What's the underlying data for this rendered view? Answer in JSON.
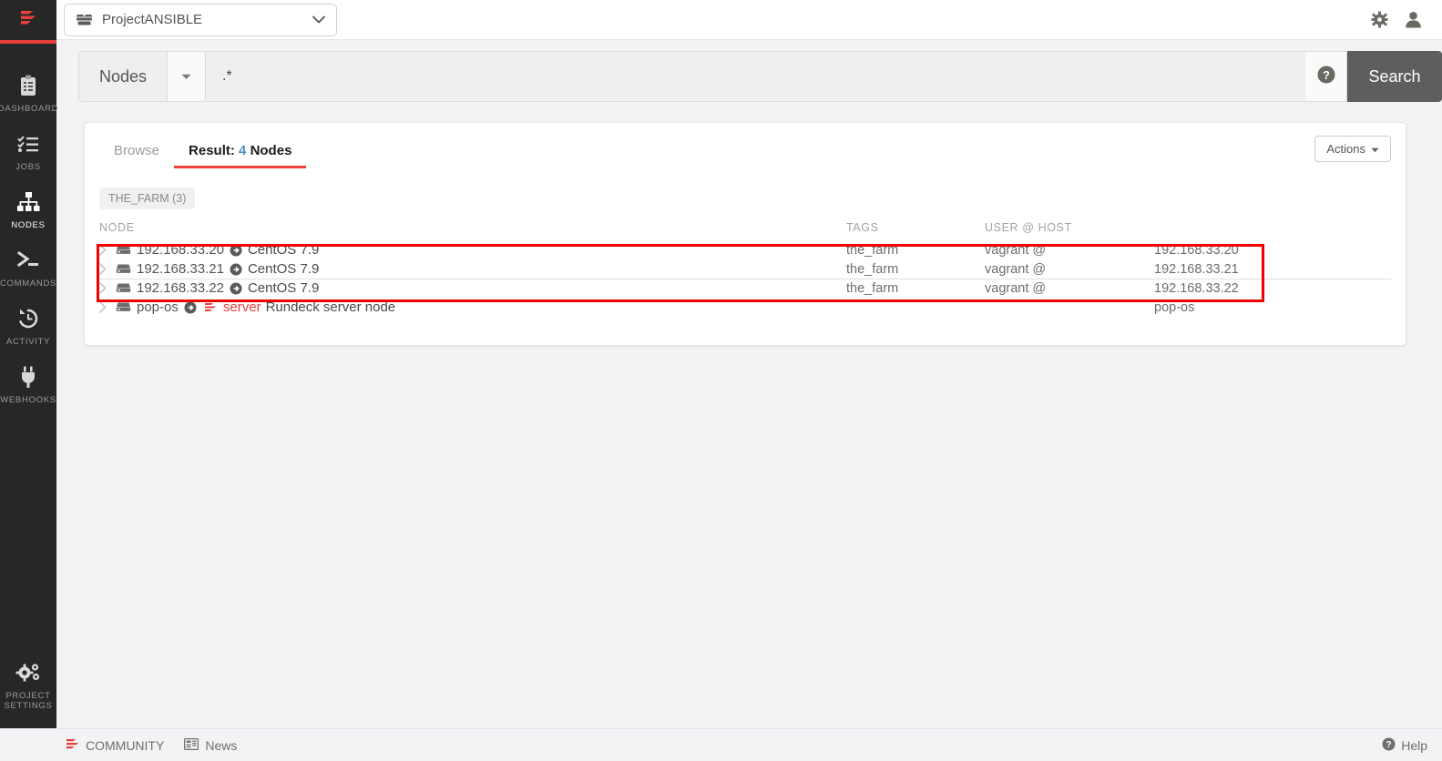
{
  "topbar": {
    "logo_icon": "rundeck-logo-icon",
    "project_name": "ProjectANSIBLE",
    "project_icon": "project-cube-icon",
    "caret_icon": "chevron-down-icon",
    "settings_icon": "gear-icon",
    "user_icon": "user-icon"
  },
  "sidebar": {
    "items": [
      {
        "label": "DASHBOARD",
        "icon": "clipboard-icon",
        "active": false
      },
      {
        "label": "JOBS",
        "icon": "checklist-icon",
        "active": false
      },
      {
        "label": "NODES",
        "icon": "nodes-hierarchy-icon",
        "active": true
      },
      {
        "label": "COMMANDS",
        "icon": "terminal-prompt-icon",
        "active": false
      },
      {
        "label": "ACTIVITY",
        "icon": "history-clock-icon",
        "active": false
      },
      {
        "label": "WEBHOOKS",
        "icon": "plug-icon",
        "active": false
      }
    ],
    "bottom_item": {
      "label": "PROJECT\nSETTINGS",
      "label_line1": "PROJECT",
      "label_line2": "SETTINGS",
      "icon": "gears-icon"
    }
  },
  "search": {
    "filter_label": "Nodes",
    "filter_caret_icon": "caret-down-icon",
    "query_value": ".*",
    "query_placeholder": "",
    "help_icon": "question-circle-icon",
    "search_button": "Search"
  },
  "card": {
    "tabs": [
      {
        "label": "Browse",
        "active": false
      },
      {
        "label_prefix": "Result:",
        "count": "4",
        "label_suffix": "Nodes",
        "active": true
      }
    ],
    "actions_button": "Actions",
    "actions_caret_icon": "caret-down-icon",
    "tag_badge": "THE_FARM (3)",
    "table": {
      "headers": [
        "NODE",
        "TAGS",
        "USER @ HOST",
        ""
      ],
      "rows": [
        {
          "chevron_icon": "chevron-right-icon",
          "server_icon": "server-icon",
          "node": "192.168.33.20",
          "expand_icon": "arrow-circle-right-icon",
          "os": "CentOS 7.9",
          "is_server": false,
          "server_tag": "",
          "description": "",
          "tags": "the_farm",
          "user": "vagrant @",
          "host": "192.168.33.20",
          "highlighted": true
        },
        {
          "chevron_icon": "chevron-right-icon",
          "server_icon": "server-icon",
          "node": "192.168.33.21",
          "expand_icon": "arrow-circle-right-icon",
          "os": "CentOS 7.9",
          "is_server": false,
          "server_tag": "",
          "description": "",
          "tags": "the_farm",
          "user": "vagrant @",
          "host": "192.168.33.21",
          "highlighted": true
        },
        {
          "chevron_icon": "chevron-right-icon",
          "server_icon": "server-icon",
          "node": "192.168.33.22",
          "expand_icon": "arrow-circle-right-icon",
          "os": "CentOS 7.9",
          "is_server": false,
          "server_tag": "",
          "description": "",
          "tags": "the_farm",
          "user": "vagrant @",
          "host": "192.168.33.22",
          "highlighted": true
        },
        {
          "chevron_icon": "chevron-right-icon",
          "server_icon": "server-icon",
          "node": "pop-os",
          "expand_icon": "arrow-circle-right-icon",
          "os": "",
          "is_server": true,
          "server_tag": "server",
          "description": "Rundeck server node",
          "tags": "",
          "user": "",
          "host": "pop-os",
          "highlighted": false
        }
      ]
    }
  },
  "footer": {
    "community_label": "COMMUNITY",
    "community_icon": "rundeck-logo-icon",
    "news_label": "News",
    "news_icon": "news-grid-icon",
    "help_label": "Help",
    "help_icon": "question-circle-icon"
  },
  "colors": {
    "accent_red": "#e8403a",
    "annotation_red": "#f10000",
    "count_blue": "#4a90c4",
    "sidebar_bg": "#272727",
    "page_bg": "#f2f3f5"
  }
}
